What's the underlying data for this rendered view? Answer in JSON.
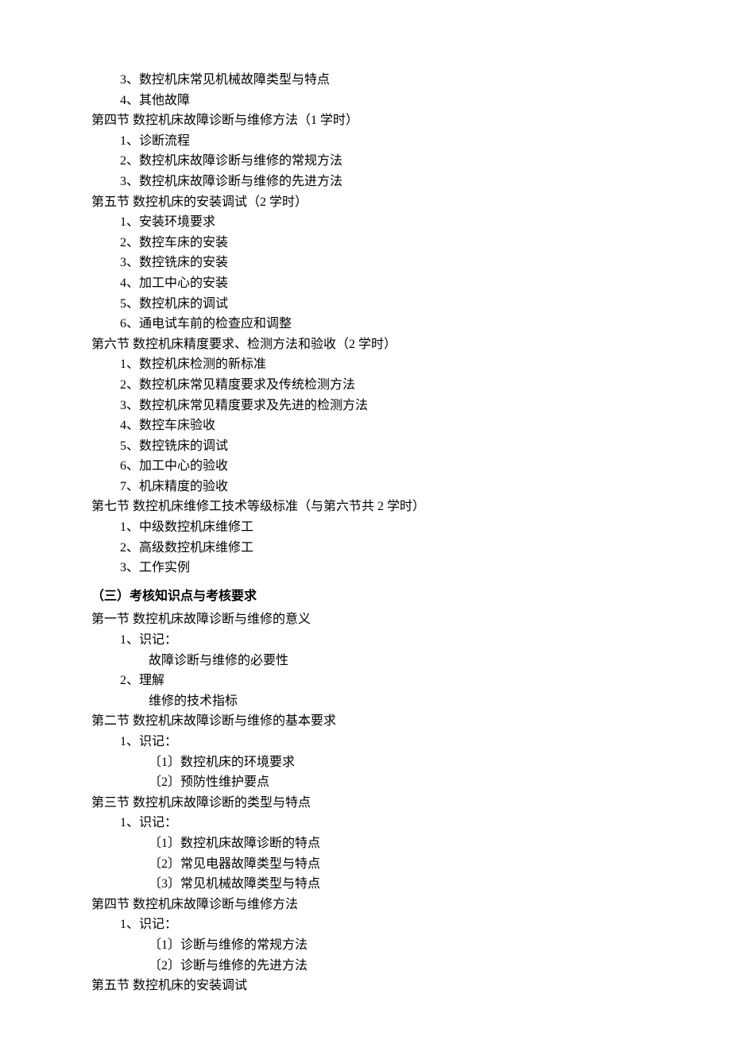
{
  "block1": {
    "items_pre": [
      "3、数控机床常见机械故障类型与特点",
      "4、其他故障"
    ],
    "sec4": {
      "title": "第四节 数控机床故障诊断与维修方法（1 学时）",
      "items": [
        "1、诊断流程",
        "2、数控机床故障诊断与维修的常规方法",
        "3、数控机床故障诊断与维修的先进方法"
      ]
    },
    "sec5": {
      "title": "第五节 数控机床的安装调试（2 学时）",
      "items": [
        "1、安装环境要求",
        "2、数控车床的安装",
        "3、数控铣床的安装",
        "4、加工中心的安装",
        "5、数控机床的调试",
        "6、通电试车前的检查应和调整"
      ]
    },
    "sec6": {
      "title": "第六节 数控机床精度要求、检测方法和验收（2 学时）",
      "items": [
        "1、数控机床检测的新标准",
        "2、数控机床常见精度要求及传统检测方法",
        "3、数控机床常见精度要求及先进的检测方法",
        "4、数控车床验收",
        "5、数控铣床的调试",
        "6、加工中心的验收",
        "7、机床精度的验收"
      ]
    },
    "sec7": {
      "title": "第七节 数控机床维修工技术等级标准（与第六节共 2 学时）",
      "items": [
        "1、中级数控机床维修工",
        "2、高级数控机床维修工",
        "3、工作实例"
      ]
    }
  },
  "heading3": "（三）考核知识点与考核要求",
  "block2": {
    "sec1": {
      "title": "第一节 数控机床故障诊断与维修的意义",
      "p1_label": "1、识记：",
      "p1_items": [
        "故障诊断与维修的必要性"
      ],
      "p2_label": "2、理解",
      "p2_items": [
        "维修的技术指标"
      ]
    },
    "sec2": {
      "title": "第二节 数控机床故障诊断与维修的基本要求",
      "p1_label": "1、识记：",
      "p1_items": [
        "〔1〕数控机床的环境要求",
        "〔2〕预防性维护要点"
      ]
    },
    "sec3": {
      "title": "第三节 数控机床故障诊断的类型与特点",
      "p1_label": "1、识记：",
      "p1_items": [
        "〔1〕数控机床故障诊断的特点",
        "〔2〕常见电器故障类型与特点",
        "〔3〕常见机械故障类型与特点"
      ]
    },
    "sec4": {
      "title": "第四节 数控机床故障诊断与维修方法",
      "p1_label": "1、识记：",
      "p1_items": [
        "〔1〕诊断与维修的常规方法",
        "〔2〕诊断与维修的先进方法"
      ]
    },
    "sec5": {
      "title": "第五节 数控机床的安装调试"
    }
  }
}
